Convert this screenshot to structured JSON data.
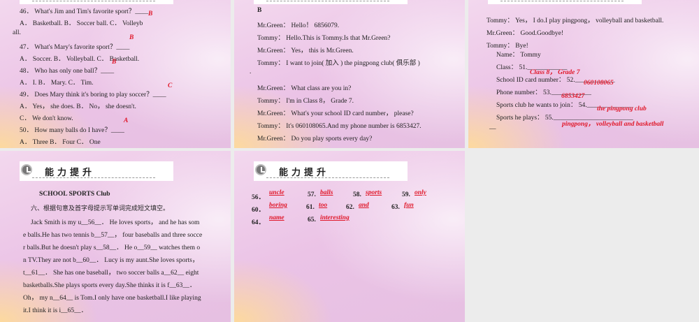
{
  "header_title": "能力提升",
  "slide1": {
    "lines": [
      "46． What's Jim and Tim's favorite sport？____",
      "A． Basketball.              B． Soccer ball.        C． Volleyb",
      "all.",
      "47． What's Mary's favorite sport？____",
      "A． Soccer.   B． Volleyball.    C． Basketball.",
      "48． Who has only one ball？____",
      "A． I.                       B． Mary.                   C． Tim.",
      "49． Does Mary think it's boring to play soccer？____",
      "A． Yes， she does.                 B． No， she doesn't.",
      "C． We don't know.",
      "50． How many balls do I have？____",
      "A． Three    B． Four    C． One"
    ],
    "answers": [
      "B",
      "B",
      "B",
      "C",
      "A"
    ]
  },
  "slide2": {
    "lines": [
      "B",
      "Mr.Green： Hello！ 6856079.",
      "Tommy： Hello.This is Tommy.Is that Mr.Green?",
      "Mr.Green： Yes， this is Mr.Green.",
      "Tommy： I want to join( 加入 ) the pingpong club( 俱乐部 )",
      ".",
      "Mr.Green： What class are you in?",
      "Tommy： I'm in Class 8， Grade 7.",
      "Mr.Green： What's your school ID card number， please?",
      "Tommy： It's 060108065.And my phone number is 6853427.",
      "Mr.Green： Do you play sports every day?"
    ]
  },
  "slide3": {
    "lines": [
      "Tommy： Yes， I do.I play pingpong， volleyball and basketball.",
      "Mr.Green： Good.Goodbye!",
      "Tommy： Bye!",
      "Name： Tommy",
      "Class： 51.____________",
      "School ID card number： 52.____________",
      "Phone number： 53.____________",
      "Sports club he wants to join： 54.______________",
      "Sports he plays： 55.________________________",
      "—"
    ],
    "answers": [
      "Class 8， Grade 7",
      "060108065",
      "6853427",
      "the pingpong club",
      "pingpong， volleyball and basketball"
    ]
  },
  "slide4": {
    "title": "SCHOOL SPORTS Club",
    "instruction": "六、根据句意及首字母提示写单词完成短文填空。",
    "lines": [
      "Jack Smith is my u__56__． He loves sports， and he has som",
      "e balls.He has two tennis b__57__， four baseballs and three socce",
      "r balls.But he doesn't play s__58__． He o__59__ watches them o",
      "n TV.They are not b__60__． Lucy is my aunt.She loves sports，",
      "t__61__． She has one baseball， two soccer balls a__62__ eight",
      "basketballs.She plays sports every day.She thinks it is f__63__．",
      "Oh， my n__64__ is Tom.I only have one basketball.I like playing",
      "it.I think it is i__65__．"
    ]
  },
  "slide5": {
    "items": [
      {
        "num": "56．",
        "ans": "uncle"
      },
      {
        "num": "57.",
        "ans": "balls"
      },
      {
        "num": "58.",
        "ans": "sports"
      },
      {
        "num": "59.",
        "ans": "only"
      },
      {
        "num": "60．",
        "ans": "boring"
      },
      {
        "num": "61.",
        "ans": "too"
      },
      {
        "num": "62.",
        "ans": "and"
      },
      {
        "num": "63.",
        "ans": "fun"
      },
      {
        "num": "64．",
        "ans": "name"
      },
      {
        "num": "65.",
        "ans": "interesting"
      }
    ]
  }
}
